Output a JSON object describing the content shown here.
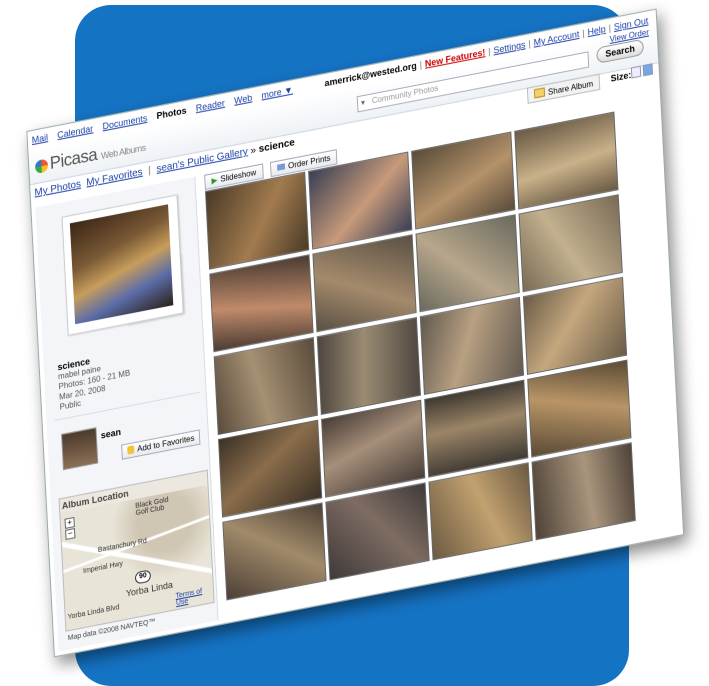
{
  "topnav": {
    "links": [
      "Mail",
      "Calendar",
      "Documents",
      "Photos",
      "Reader",
      "Web",
      "more ▼"
    ],
    "current_index": 3
  },
  "account": {
    "email": "amerrick@wested.org",
    "new_features": "New Features!",
    "settings": "Settings",
    "my_account": "My Account",
    "help": "Help",
    "sign_out": "Sign Out"
  },
  "header": {
    "logo": "Picasa",
    "logo_sub": "Web Albums",
    "search_placeholder": "Community Photos",
    "search_button": "Search",
    "view_order": "View Order"
  },
  "breadcrumb": {
    "my_photos": "My Photos",
    "my_favorites": "My Favorites",
    "gallery": "sean's Public Gallery",
    "arrow": "»",
    "album": "science"
  },
  "actions": {
    "share_album": "Share Album",
    "size_label": "Size:",
    "slideshow": "Slideshow",
    "order_prints": "Order Prints"
  },
  "album": {
    "title": "science",
    "owner": "mabel paine",
    "photos": "Photos: 160 - 21 MB",
    "date": "Mar 20, 2008",
    "visibility": "Public"
  },
  "owner_card": {
    "name": "sean",
    "add_favorites": "Add to Favorites"
  },
  "location": {
    "title": "Album Location",
    "labels": [
      "Black Gold Golf Club",
      "Bastanchury Rd",
      "Imperial Hwy",
      "Yorba Linda",
      "Yorba Linda Blvd",
      "Terms of Use"
    ],
    "highway": "90",
    "copyright": "Map data ©2008 NAVTEQ™"
  },
  "photos": {
    "count": 20,
    "colors": [
      [
        "#4a3a26",
        "#a27b4f"
      ],
      [
        "#3a3f55",
        "#c79a7a"
      ],
      [
        "#5a4c3a",
        "#b4926a"
      ],
      [
        "#6a5a44",
        "#c9b18a"
      ],
      [
        "#4b3c33",
        "#c08a6a"
      ],
      [
        "#5a5043",
        "#a48a6c"
      ],
      [
        "#6a6a5e",
        "#b7a68b"
      ],
      [
        "#7a6b55",
        "#c2b08e"
      ],
      [
        "#5b4c3c",
        "#a59073"
      ],
      [
        "#4e473f",
        "#9b8b72"
      ],
      [
        "#625a4f",
        "#b8a082"
      ],
      [
        "#6b5c47",
        "#c4a77e"
      ],
      [
        "#3c3226",
        "#8a6d4b"
      ],
      [
        "#4a3f38",
        "#a68f7a"
      ],
      [
        "#403a33",
        "#9b8567"
      ],
      [
        "#5b4a36",
        "#b89566"
      ],
      [
        "#4c4035",
        "#a18a6a"
      ],
      [
        "#3f3a3a",
        "#7e6c62"
      ],
      [
        "#6b5a42",
        "#c2a16f"
      ],
      [
        "#4f4338",
        "#a9957d"
      ]
    ]
  }
}
